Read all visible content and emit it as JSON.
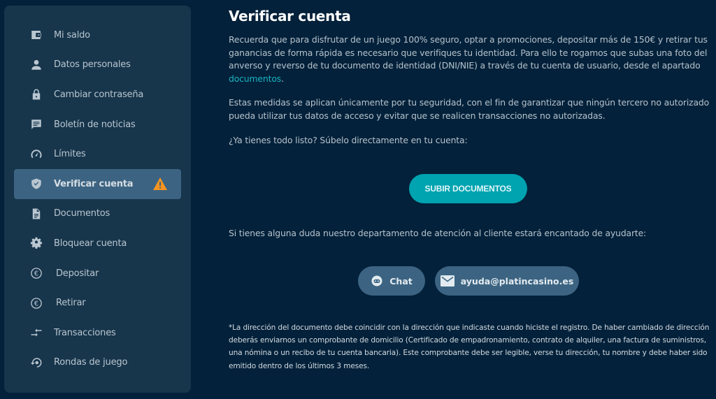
{
  "sidebar": {
    "items": [
      {
        "label": "Mi saldo",
        "icon": "wallet-icon",
        "active": false
      },
      {
        "label": "Datos personales",
        "icon": "person-icon",
        "active": false
      },
      {
        "label": "Cambiar contraseña",
        "icon": "lock-icon",
        "active": false
      },
      {
        "label": "Boletín de noticias",
        "icon": "chat-bubble-icon",
        "active": false
      },
      {
        "label": "Límites",
        "icon": "speedometer-icon",
        "active": false
      },
      {
        "label": "Verificar cuenta",
        "icon": "shield-check-icon",
        "active": true,
        "badge": "warning-icon"
      },
      {
        "label": "Documentos",
        "icon": "document-icon",
        "active": false
      },
      {
        "label": "Bloquear cuenta",
        "icon": "gear-icon",
        "active": false
      },
      {
        "label": "Depositar",
        "icon": "euro-icon",
        "active": false
      },
      {
        "label": "Retirar",
        "icon": "euro-icon",
        "active": false
      },
      {
        "label": "Transacciones",
        "icon": "transfer-arrows-icon",
        "active": false
      },
      {
        "label": "Rondas de juego",
        "icon": "history-icon",
        "active": false
      }
    ]
  },
  "main": {
    "title": "Verificar cuenta",
    "paragraph1": "Recuerda que para disfrutar de un juego 100% seguro, optar a promociones, depositar más de 150€ y retirar tus ganancias de forma rápida es necesario que verifiques tu identidad. Para ello te rogamos que subas una foto del anverso y reverso de tu documento de identidad (DNI/NIE) a través de tu cuenta de usuario, desde el apartado ",
    "paragraph1_link": "documentos",
    "paragraph1_end": ".",
    "paragraph2": "Estas medidas se aplican únicamente por tu seguridad, con el fin de garantizar que ningún tercero no autorizado pueda utilizar tus datos de acceso y evitar que se realicen transacciones no autorizadas.",
    "paragraph3": "¿Ya tienes todo listo? Súbelo directamente en tu cuenta:",
    "upload_button": "SUBIR DOCUMENTOS",
    "help_text": "Si tienes alguna duda nuestro departamento de atención al cliente estará encantado de ayudarte:",
    "chat_button": "Chat",
    "email_button": "ayuda@platincasino.es",
    "footnote": "*La dirección del documento debe coincidir con la dirección que indicaste cuando hiciste el registro. De haber cambiado de dirección deberás enviarnos un comprobante de domicilio (Certificado de empadronamiento, contrato de alquiler, una factura de suministros, una nómina o un recibo de tu cuenta bancaria). Este comprobante debe ser legible, verse tu dirección, tu nombre y debe haber sido emitido dentro de los últimos 3 meses."
  },
  "colors": {
    "background": "#03213a",
    "sidebar": "#17354b",
    "active": "#3c6482",
    "accent": "#00a3b0",
    "link": "#1ab3c4",
    "warning": "#f7931e"
  }
}
